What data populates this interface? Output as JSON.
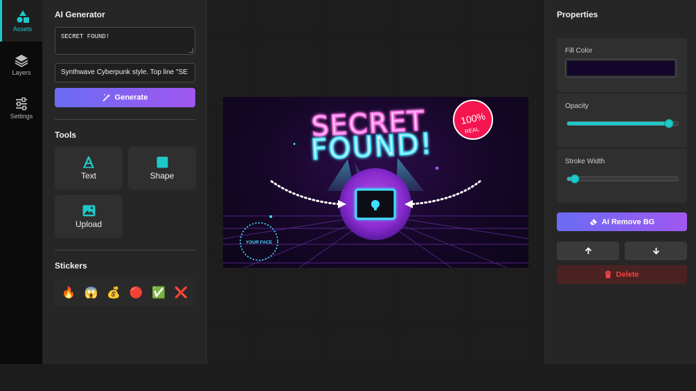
{
  "rail": {
    "items": [
      {
        "label": "Assets",
        "icon": "shapes-icon",
        "active": true
      },
      {
        "label": "Layers",
        "icon": "layers-icon"
      },
      {
        "label": "Settings",
        "icon": "sliders-icon"
      }
    ]
  },
  "generator": {
    "title": "AI Generator",
    "headline_value": "SECRET FOUND!",
    "prompt_value": "Synthwave Cyberpunk style. Top line \"SE",
    "generate_label": "Generate"
  },
  "tools": {
    "title": "Tools",
    "items": [
      {
        "label": "Text",
        "icon": "text-icon"
      },
      {
        "label": "Shape",
        "icon": "square-icon"
      },
      {
        "label": "Upload",
        "icon": "image-icon"
      }
    ]
  },
  "stickers": {
    "title": "Stickers",
    "items": [
      "🔥",
      "😱",
      "💰",
      "🔴",
      "✅",
      "❌"
    ]
  },
  "canvas": {
    "line1": "SECRET",
    "line2": "FOUND!",
    "badge_top": "100%",
    "badge_bottom": "REAL",
    "circle_label": "YOUR FACE"
  },
  "properties": {
    "title": "Properties",
    "fill_label": "Fill Color",
    "fill_color": "#14062a",
    "opacity_label": "Opacity",
    "opacity_value": 0.92,
    "stroke_label": "Stroke Width",
    "stroke_value": 0.07,
    "remove_bg_label": "AI Remove BG",
    "delete_label": "Delete"
  },
  "colors": {
    "accent": "#1fc8c8",
    "gradient_start": "#6b6cf2",
    "gradient_end": "#a057f0",
    "danger": "#ef4444",
    "neon_pink": "#ff6ee8",
    "neon_cyan": "#3fe0ff",
    "badge": "#f5154f"
  }
}
